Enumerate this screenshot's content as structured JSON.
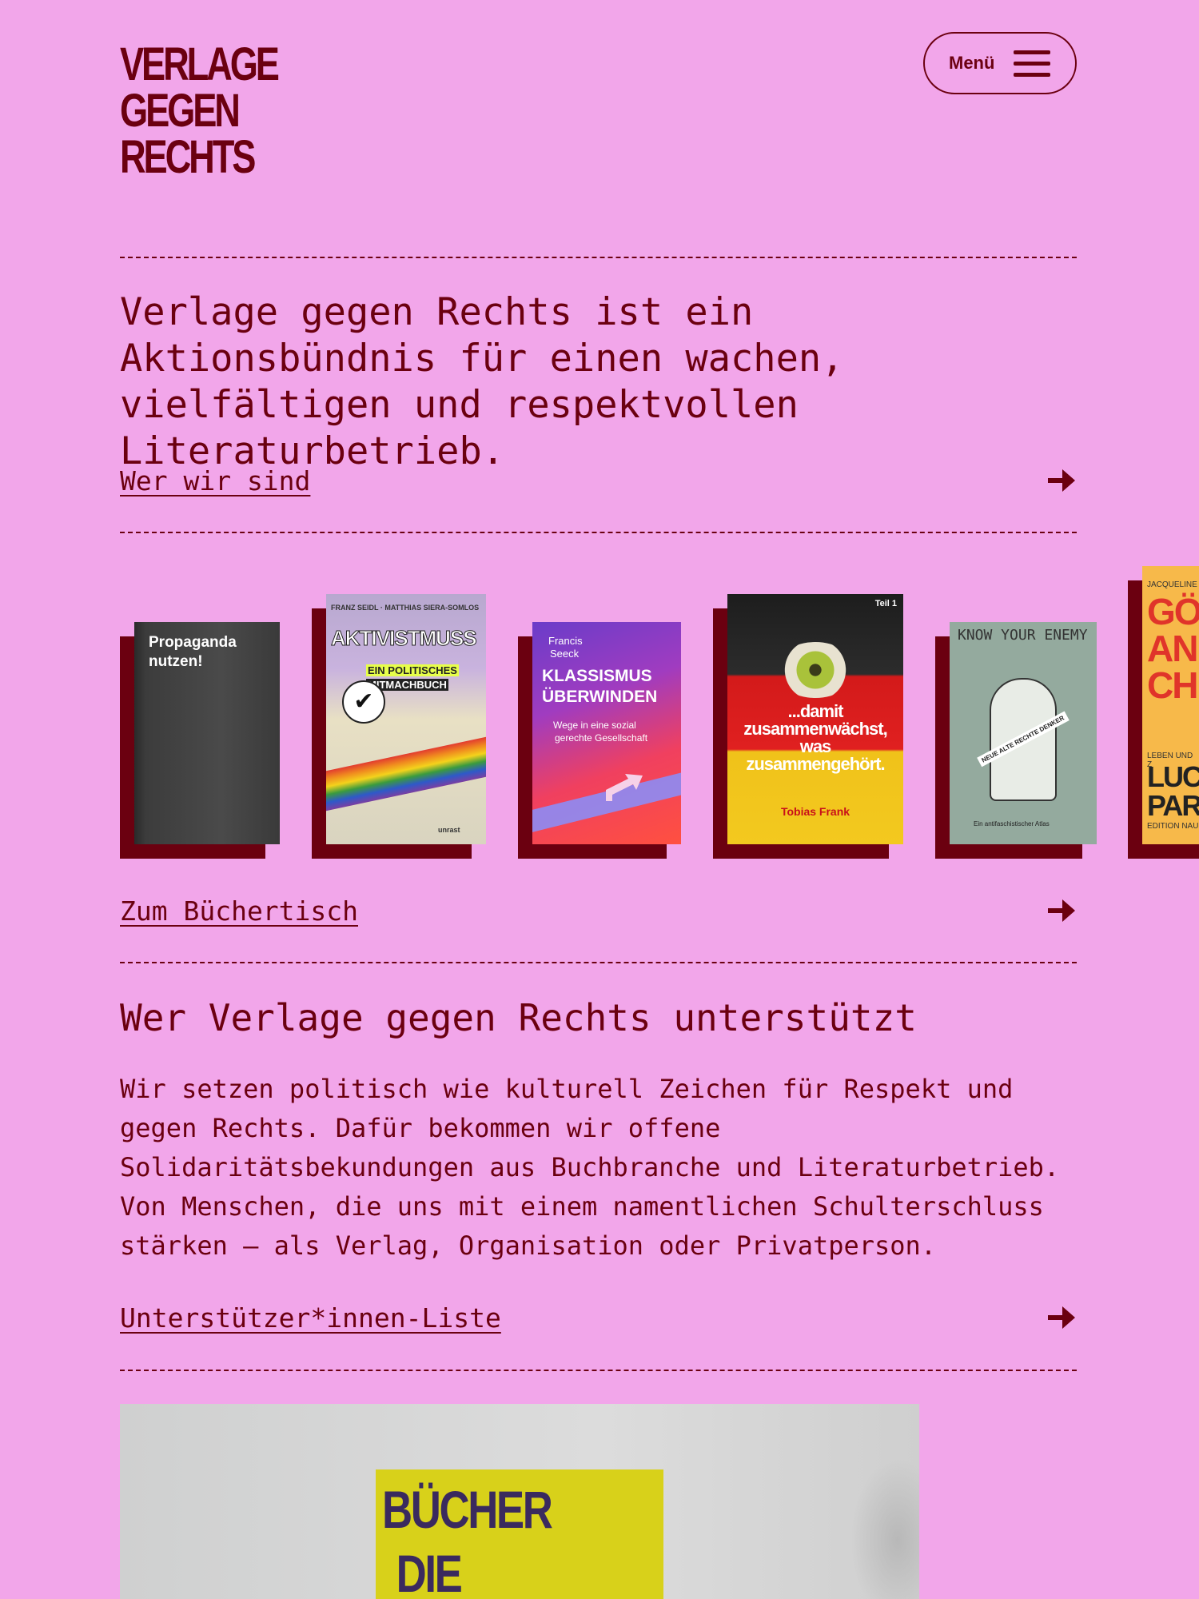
{
  "brand": {
    "logo_lines": [
      "VERLAGE",
      "GEGEN",
      "RECHTS"
    ]
  },
  "header": {
    "menu_label": "Menü"
  },
  "intro": {
    "text": "Verlage gegen Rechts ist ein Aktionsbündnis für einen wachen, vielfältigen und respektvollen Literaturbetrieb.",
    "link_label": "Wer wir sind"
  },
  "books": {
    "items": [
      {
        "title_lines": [
          "Propaganda",
          "nutzen!"
        ]
      },
      {
        "author": "FRANZ SEIDL · MATTHIAS SIERA-SOMLOS",
        "title": "AKTIVISTMUSS",
        "subtitle_lines": [
          "EIN POLITISCHES",
          "MITMACHBUCH"
        ],
        "publisher": "unrast"
      },
      {
        "author_lines": [
          "Francis",
          "Seeck"
        ],
        "title_lines": [
          "KLASSISMUS",
          "ÜBERWINDEN"
        ],
        "subtitle_lines": [
          "Wege in eine sozial",
          "gerechte Gesellschaft"
        ]
      },
      {
        "volume": "Teil 1",
        "title_lines": [
          "...damit",
          "zusammenwächst,",
          "was",
          "zusammengehört."
        ],
        "author": "Tobias Frank"
      },
      {
        "title": "KNOW YOUR ENEMY",
        "banner": "NEUE ALTE RECHTE DENKER",
        "footer": "Ein antifaschistischer Atlas"
      },
      {
        "author_top": "JACQUELINE",
        "title_lines": [
          "GÖT",
          "AN",
          "CH"
        ],
        "sub": "LEBEN UND Z",
        "lower_lines": [
          "LUC",
          "PAR"
        ],
        "publisher": "EDITION NAU"
      }
    ],
    "link_label": "Zum Büchertisch"
  },
  "supporters": {
    "heading": "Wer Verlage gegen Rechts unterstützt",
    "text": "Wir setzen politisch wie kulturell Zeichen für Respekt und gegen Rechts. Dafür bekommen wir offene Solidaritätsbekundungen aus Buchbranche und Literaturbetrieb. Von Menschen, die uns mit einem namentlichen Schulterschluss stärken – als Verlag, Organisation oder Privatperson.",
    "link_label": "Unterstützer*innen-Liste"
  },
  "photo": {
    "poster_lines": [
      "BÜCHER",
      "DIE"
    ]
  },
  "colors": {
    "background": "#f2a6ea",
    "accent": "#6b0010"
  }
}
